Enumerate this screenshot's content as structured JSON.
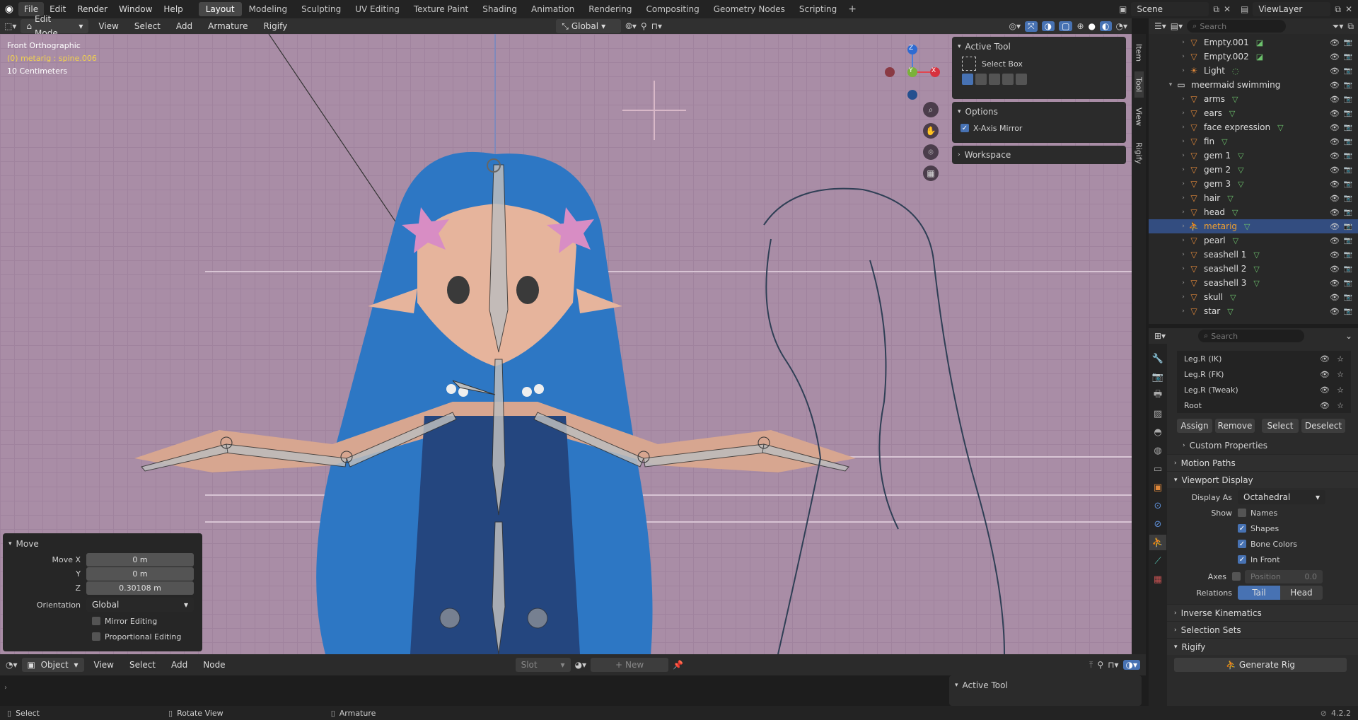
{
  "topbar": {
    "menus": [
      "File",
      "Edit",
      "Render",
      "Window",
      "Help"
    ],
    "tabs": [
      "Layout",
      "Modeling",
      "Sculpting",
      "UV Editing",
      "Texture Paint",
      "Shading",
      "Animation",
      "Rendering",
      "Compositing",
      "Geometry Nodes",
      "Scripting"
    ],
    "active_tab": "Layout",
    "scene": "Scene",
    "view_layer": "ViewLayer"
  },
  "viewport_header": {
    "mode": "Edit Mode",
    "menus": [
      "View",
      "Select",
      "Add",
      "Armature",
      "Rigify"
    ],
    "orientation": "Global"
  },
  "viewport": {
    "view_name": "Front Orthographic",
    "object_info": "(0) metarig : spine.006",
    "scale": "10 Centimeters",
    "gizmo": {
      "z": "Z",
      "y": "Y",
      "x": "X"
    }
  },
  "sidebar": {
    "active_tool_title": "Active Tool",
    "tool_name": "Select Box",
    "options_title": "Options",
    "x_axis_mirror": "X-Axis Mirror",
    "workspace_title": "Workspace",
    "tabs": [
      "Item",
      "Tool",
      "View",
      "Rigify"
    ]
  },
  "move_panel": {
    "title": "Move",
    "move_x_label": "Move X",
    "move_x": "0 m",
    "y_label": "Y",
    "y": "0 m",
    "z_label": "Z",
    "z": "0.30108 m",
    "orientation_label": "Orientation",
    "orientation": "Global",
    "mirror_editing": "Mirror Editing",
    "proportional_editing": "Proportional Editing"
  },
  "bottom_header": {
    "mode": "Object",
    "menus": [
      "View",
      "Select",
      "Add",
      "Node"
    ],
    "slot": "Slot",
    "new_label": "New",
    "active_tool": "Active Tool"
  },
  "statusbar": {
    "select": "Select",
    "rotate": "Rotate View",
    "armature": "Armature",
    "version": "4.2.2"
  },
  "outliner": {
    "search_placeholder": "Search",
    "rows": [
      {
        "name": "Empty.001",
        "indent": 1
      },
      {
        "name": "Empty.002",
        "indent": 1
      },
      {
        "name": "Light",
        "indent": 1
      },
      {
        "name": "meermaid swimming",
        "indent": 0
      },
      {
        "name": "arms",
        "indent": 1
      },
      {
        "name": "ears",
        "indent": 1
      },
      {
        "name": "face expression",
        "indent": 1
      },
      {
        "name": "fin",
        "indent": 1
      },
      {
        "name": "gem 1",
        "indent": 1
      },
      {
        "name": "gem 2",
        "indent": 1
      },
      {
        "name": "gem 3",
        "indent": 1
      },
      {
        "name": "hair",
        "indent": 1
      },
      {
        "name": "head",
        "indent": 1
      },
      {
        "name": "metarig",
        "indent": 1,
        "selected": true
      },
      {
        "name": "pearl",
        "indent": 1
      },
      {
        "name": "seashell 1",
        "indent": 1
      },
      {
        "name": "seashell 2",
        "indent": 1
      },
      {
        "name": "seashell 3",
        "indent": 1
      },
      {
        "name": "skull",
        "indent": 1
      },
      {
        "name": "star",
        "indent": 1
      }
    ]
  },
  "properties": {
    "search_placeholder": "Search",
    "bone_collections": [
      "Leg.R (IK)",
      "Leg.R (FK)",
      "Leg.R (Tweak)",
      "Root"
    ],
    "assign": "Assign",
    "remove": "Remove",
    "select": "Select",
    "deselect": "Deselect",
    "custom_properties": "Custom Properties",
    "motion_paths": "Motion Paths",
    "viewport_display": "Viewport Display",
    "display_as_label": "Display As",
    "display_as": "Octahedral",
    "show_label": "Show",
    "show_names": "Names",
    "show_shapes": "Shapes",
    "show_bone_colors": "Bone Colors",
    "show_in_front": "In Front",
    "axes_label": "Axes",
    "position_label": "Position",
    "position_value": "0.0",
    "relations_label": "Relations",
    "tail": "Tail",
    "head": "Head",
    "inverse_kinematics": "Inverse Kinematics",
    "selection_sets": "Selection Sets",
    "rigify": "Rigify",
    "generate_rig": "Generate Rig"
  },
  "colors": {
    "accent": "#4772b3",
    "viewport_bg": "#a98da6",
    "selected_row": "#334d80"
  }
}
